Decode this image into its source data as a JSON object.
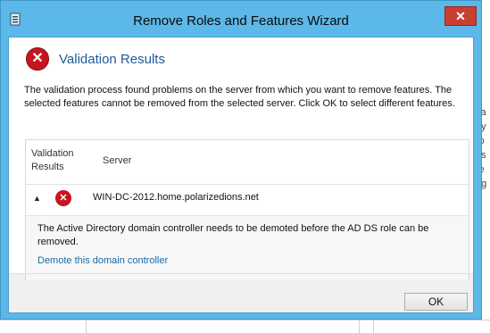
{
  "window": {
    "title": "Remove Roles and Features Wizard",
    "close_glyph": "✕"
  },
  "header": {
    "title": "Validation Results"
  },
  "description": "The validation process found problems on the server from which you want to remove features. The selected features cannot be removed from the selected server.  Click OK to select different features.",
  "results": {
    "columns": {
      "validation": "Validation Results",
      "server": "Server"
    },
    "row": {
      "server": "WIN-DC-2012.home.polarizedions.net",
      "detail": "The Active Directory domain controller needs to be demoted before the AD DS role can be removed.",
      "link": "Demote this domain controller"
    }
  },
  "buttons": {
    "ok": "OK"
  },
  "colors": {
    "error": "#c5161d",
    "link": "#1a6aa8",
    "title_accent": "#1e5a96",
    "frame": "#5bb8e8"
  },
  "icons": {
    "app": "server-manager-icon",
    "error": "error-icon",
    "expand": "chevron-up-icon",
    "close": "close-icon"
  }
}
